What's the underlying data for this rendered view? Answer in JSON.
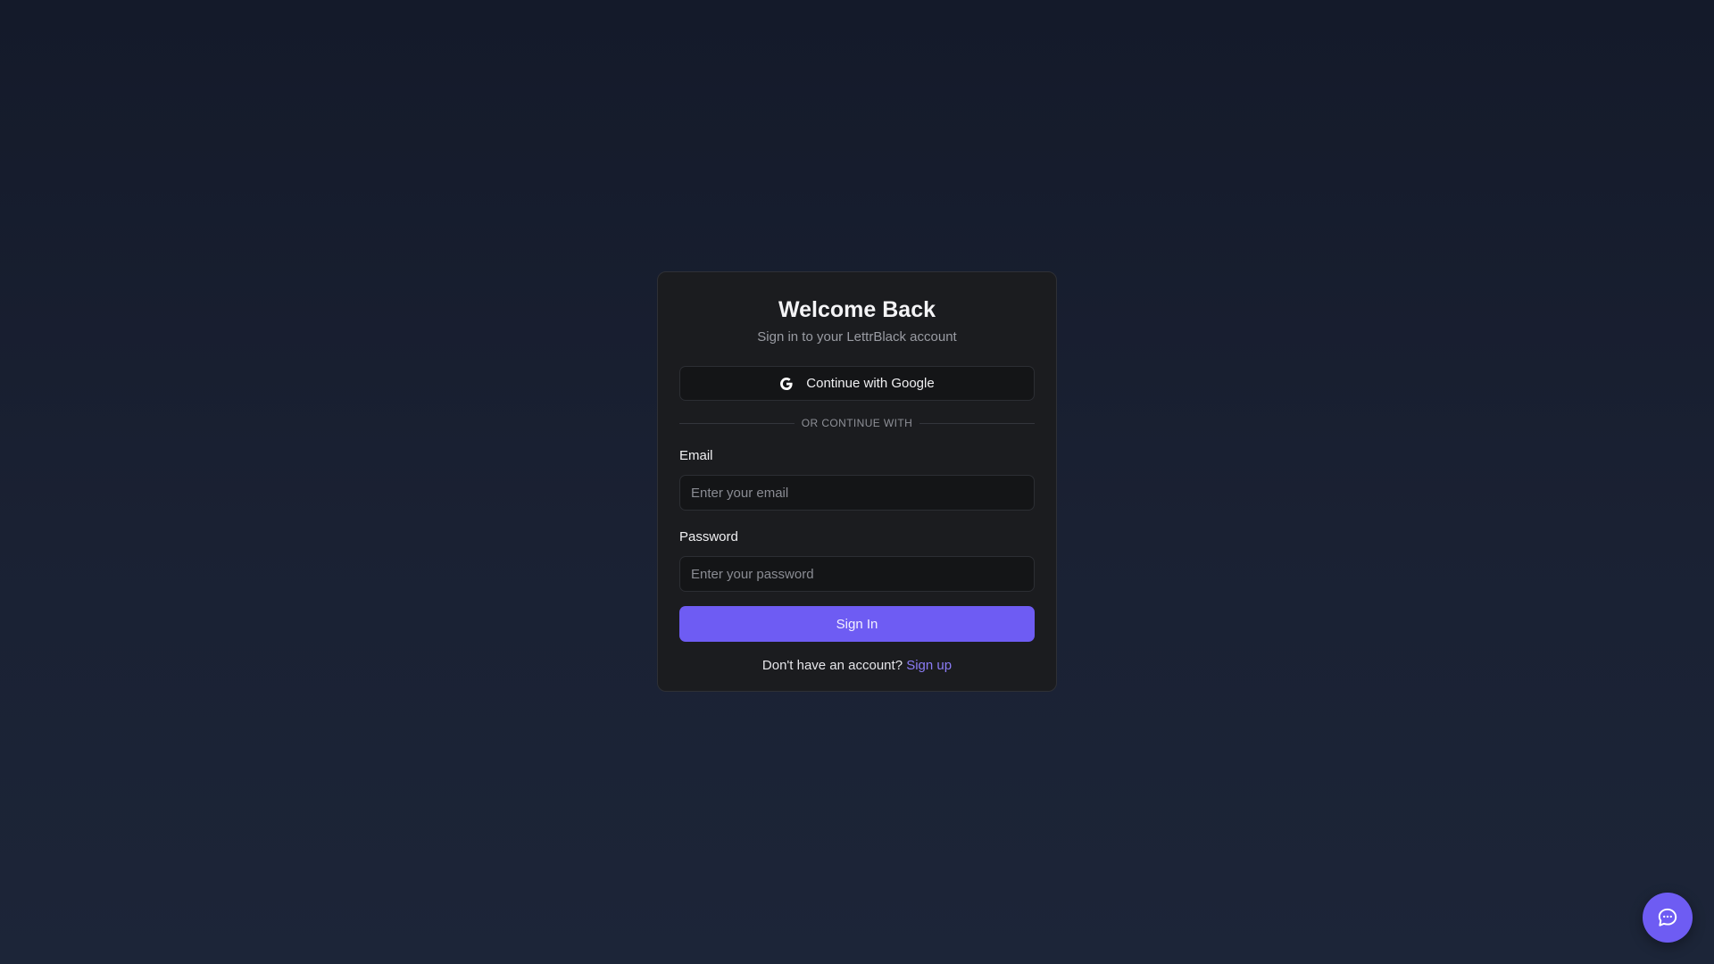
{
  "login": {
    "title": "Welcome Back",
    "subtitle": "Sign in to your LettrBlack account",
    "google_button": {
      "icon": "google-icon",
      "label": "Continue with Google"
    },
    "divider_text": "OR CONTINUE WITH",
    "email": {
      "label": "Email",
      "placeholder": "Enter your email",
      "value": ""
    },
    "password": {
      "label": "Password",
      "placeholder": "Enter your password",
      "value": ""
    },
    "signin_label": "Sign In",
    "footer_text": "Don't have an account?",
    "signup_link": "Sign up"
  },
  "chat_button": {
    "icon": "chat-bubble-icon"
  },
  "colors": {
    "accent": "#6e5cf3",
    "link": "#8b7cf6",
    "card_bg": "#1b1c1f",
    "page_bg": "#161c2c"
  }
}
